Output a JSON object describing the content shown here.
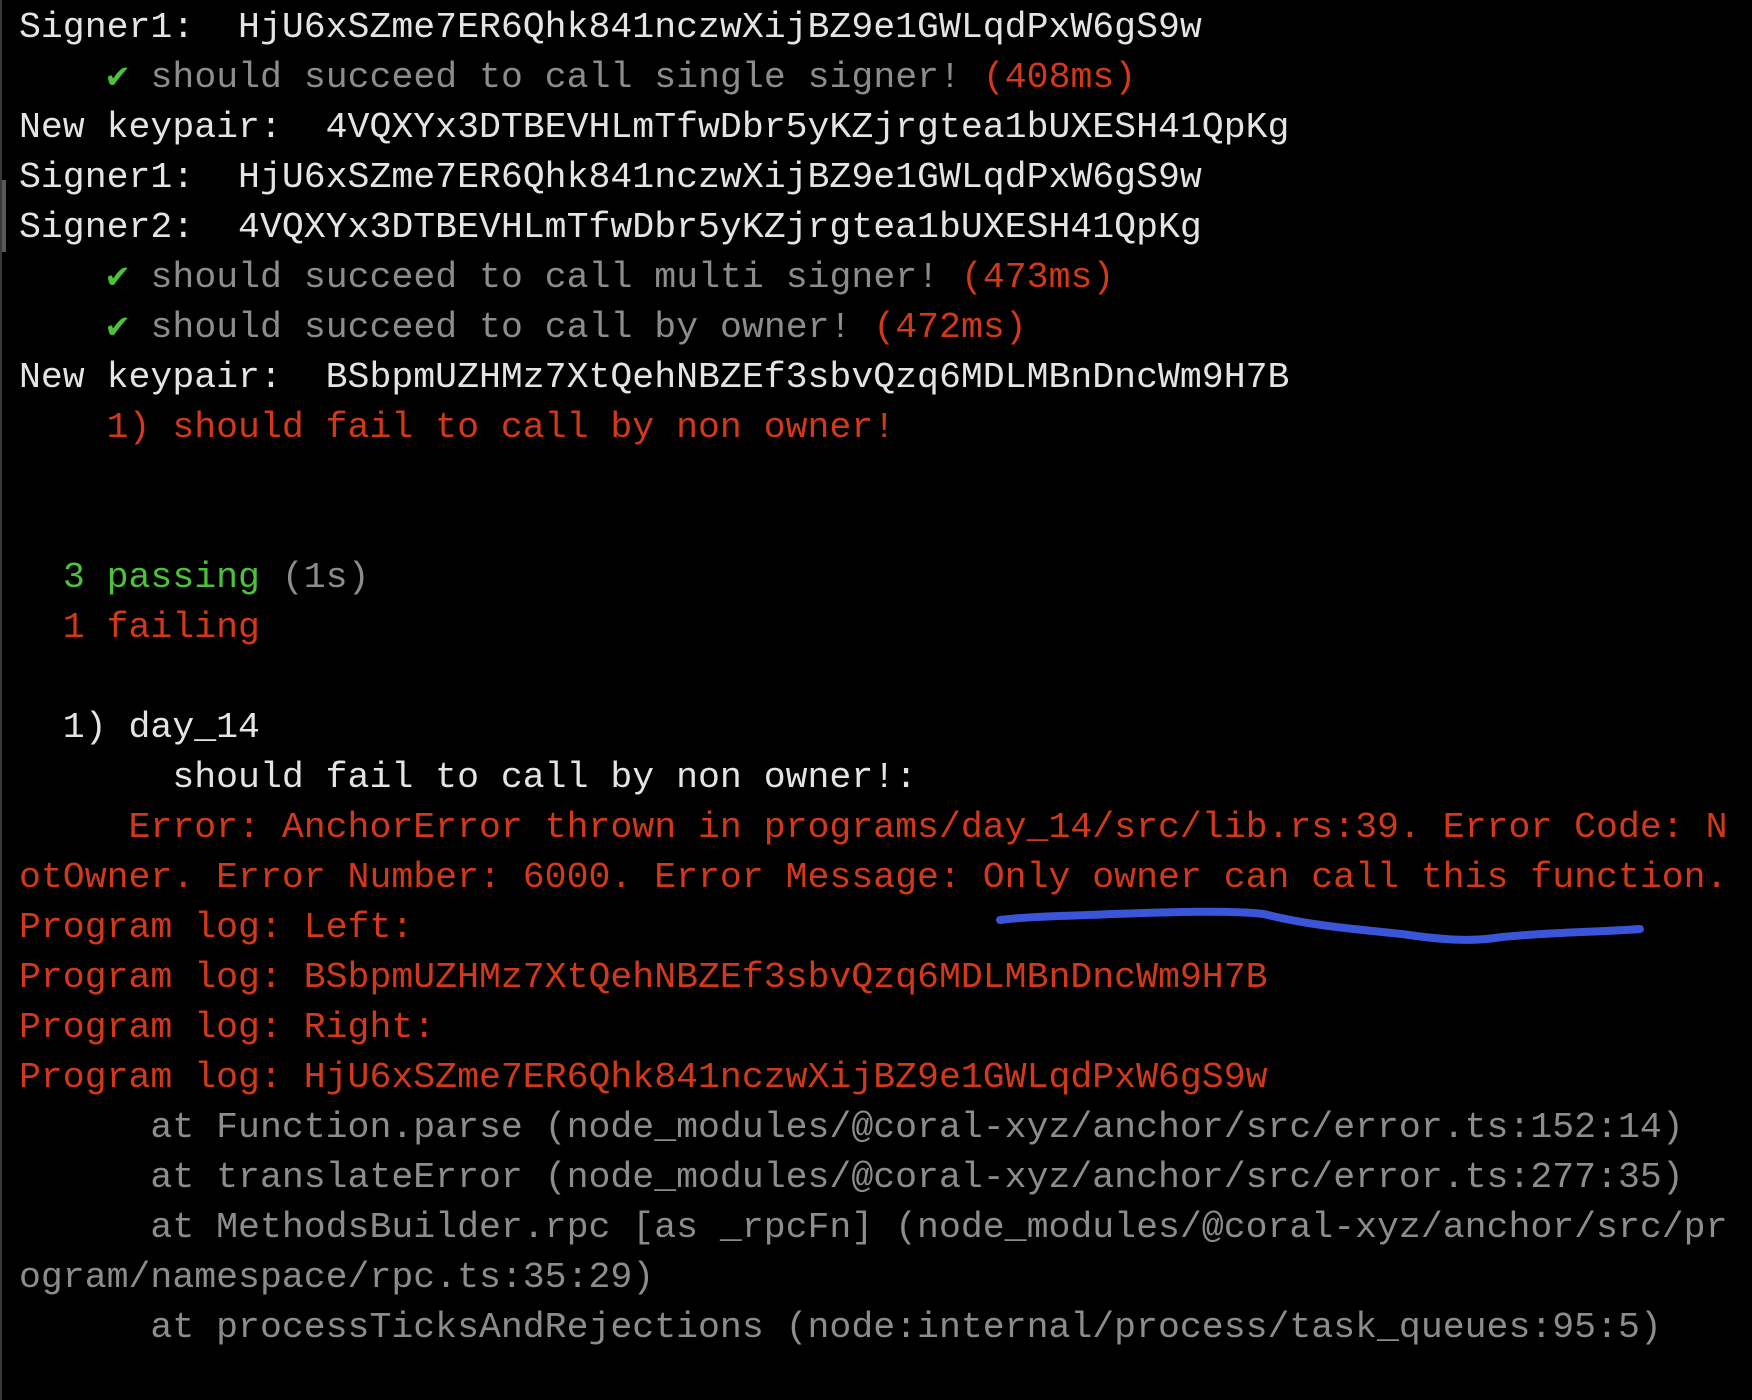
{
  "colors": {
    "text": "#e4e4e4",
    "muted": "#8c8c8c",
    "pass": "#4cc13a",
    "fail": "#d2391b",
    "annotation": "#3a55d8",
    "background": "#000000"
  },
  "lines": [
    {
      "segments": [
        {
          "text": "Signer1:  HjU6xSZme7ER6Qhk841nczwXijBZ9e1GWLqdPxW6gS9w",
          "color": "white"
        }
      ]
    },
    {
      "segments": [
        {
          "text": "    ",
          "color": "white"
        },
        {
          "text": "✔",
          "color": "green",
          "icon": "checkmark-icon"
        },
        {
          "text": " should succeed to call single signer! ",
          "color": "grey"
        },
        {
          "text": "(408ms)",
          "color": "red"
        }
      ]
    },
    {
      "segments": [
        {
          "text": "New keypair:  4VQXYx3DTBEVHLmTfwDbr5yKZjrgtea1bUXESH41QpKg",
          "color": "white"
        }
      ]
    },
    {
      "segments": [
        {
          "text": "Signer1:  HjU6xSZme7ER6Qhk841nczwXijBZ9e1GWLqdPxW6gS9w",
          "color": "white"
        }
      ]
    },
    {
      "segments": [
        {
          "text": "Signer2:  4VQXYx3DTBEVHLmTfwDbr5yKZjrgtea1bUXESH41QpKg",
          "color": "white"
        }
      ]
    },
    {
      "segments": [
        {
          "text": "    ",
          "color": "white"
        },
        {
          "text": "✔",
          "color": "green",
          "icon": "checkmark-icon"
        },
        {
          "text": " should succeed to call multi signer! ",
          "color": "grey"
        },
        {
          "text": "(473ms)",
          "color": "red"
        }
      ]
    },
    {
      "segments": [
        {
          "text": "    ",
          "color": "white"
        },
        {
          "text": "✔",
          "color": "green",
          "icon": "checkmark-icon"
        },
        {
          "text": " should succeed to call by owner! ",
          "color": "grey"
        },
        {
          "text": "(472ms)",
          "color": "red"
        }
      ]
    },
    {
      "segments": [
        {
          "text": "New keypair:  BSbpmUZHMz7XtQehNBZEf3sbvQzq6MDLMBnDncWm9H7B",
          "color": "white"
        }
      ]
    },
    {
      "segments": [
        {
          "text": "    1) should fail to call by non owner!",
          "color": "red"
        }
      ]
    },
    {
      "segments": []
    },
    {
      "segments": []
    },
    {
      "segments": [
        {
          "text": "  ",
          "color": "white"
        },
        {
          "text": "3 passing",
          "color": "green"
        },
        {
          "text": " (1s)",
          "color": "grey"
        }
      ]
    },
    {
      "segments": [
        {
          "text": "  1 failing",
          "color": "red"
        }
      ]
    },
    {
      "segments": []
    },
    {
      "segments": [
        {
          "text": "  1) day_14",
          "color": "white"
        }
      ]
    },
    {
      "segments": [
        {
          "text": "       should fail to call by non owner!:",
          "color": "white"
        }
      ]
    },
    {
      "segments": [
        {
          "text": "     Error: AnchorError thrown in programs/day_14/src/lib.rs:39. Error Code: N",
          "color": "red"
        }
      ]
    },
    {
      "segments": [
        {
          "text": "otOwner. Error Number: 6000. Error Message: Only owner can call this function.",
          "color": "red"
        }
      ]
    },
    {
      "segments": [
        {
          "text": "Program log: Left:",
          "color": "red"
        }
      ]
    },
    {
      "segments": [
        {
          "text": "Program log: BSbpmUZHMz7XtQehNBZEf3sbvQzq6MDLMBnDncWm9H7B",
          "color": "red"
        }
      ]
    },
    {
      "segments": [
        {
          "text": "Program log: Right:",
          "color": "red"
        }
      ]
    },
    {
      "segments": [
        {
          "text": "Program log: HjU6xSZme7ER6Qhk841nczwXijBZ9e1GWLqdPxW6gS9w",
          "color": "red"
        }
      ]
    },
    {
      "segments": [
        {
          "text": "      at Function.parse (node_modules/@coral-xyz/anchor/src/error.ts:152:14)",
          "color": "grey"
        }
      ]
    },
    {
      "segments": [
        {
          "text": "      at translateError (node_modules/@coral-xyz/anchor/src/error.ts:277:35)",
          "color": "grey"
        }
      ]
    },
    {
      "segments": [
        {
          "text": "      at MethodsBuilder.rpc [as _rpcFn] (node_modules/@coral-xyz/anchor/src/pr",
          "color": "grey"
        }
      ]
    },
    {
      "segments": [
        {
          "text": "ogram/namespace/rpc.ts:35:29)",
          "color": "grey"
        }
      ]
    },
    {
      "segments": [
        {
          "text": "      at processTicksAndRejections (node:internal/process/task_queues:95:5)",
          "color": "grey"
        }
      ]
    }
  ]
}
